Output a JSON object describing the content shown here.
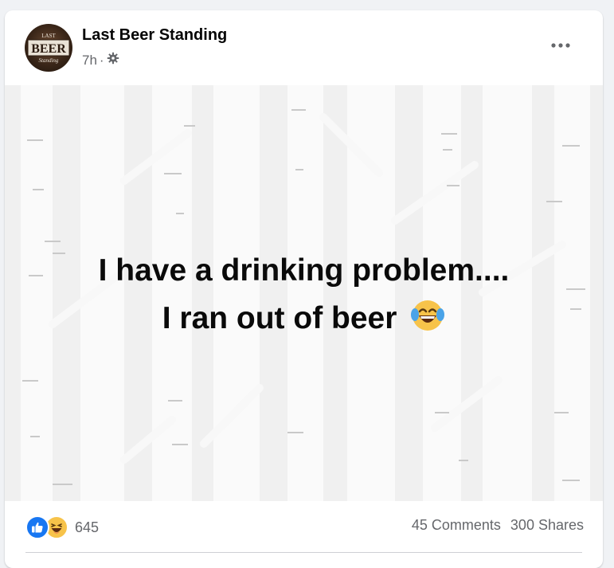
{
  "post": {
    "page_name": "Last Beer Standing",
    "time": "7h",
    "separator": "·",
    "audience_icon": "gear-icon",
    "avatar_text": "BEER",
    "avatar_text_small": "LAST",
    "avatar_text_bottom": "Standing",
    "more_icon": "more-options-icon",
    "text_line_1": "I have a drinking problem....",
    "text_line_2": "I ran out of beer",
    "text_emoji": "face-with-tears-of-joy-emoji"
  },
  "engagement": {
    "reaction_icons": [
      "like-icon",
      "haha-icon"
    ],
    "reaction_count": "645",
    "comments": "45 Comments",
    "shares": "300 Shares"
  },
  "colors": {
    "page_bg": "#f0f2f5",
    "card_bg": "#ffffff",
    "like_blue": "#1877f2",
    "haha_yellow": "#f7c34a",
    "secondary_text": "#65676b"
  }
}
